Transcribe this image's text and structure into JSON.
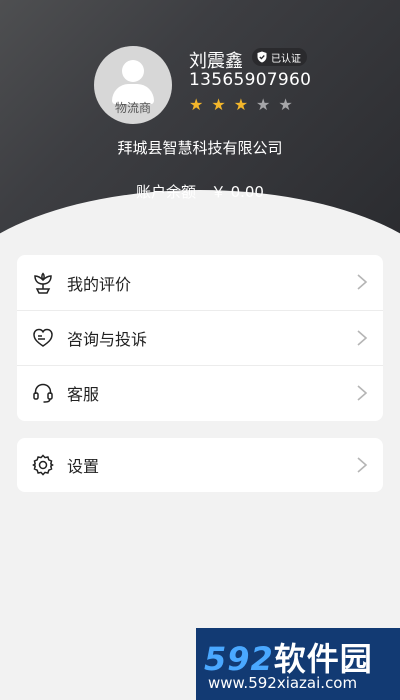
{
  "profile": {
    "role": "物流商",
    "name": "刘震鑫",
    "verified_label": "已认证",
    "phone": "13565907960",
    "rating": 3,
    "rating_max": 5,
    "company": "拜城县智慧科技有限公司",
    "balance_label": "账户余额",
    "balance_value": "￥ 0.00"
  },
  "menu": {
    "items": [
      {
        "label": "我的评价",
        "icon": "flower-icon"
      },
      {
        "label": "咨询与投诉",
        "icon": "heart-chat-icon"
      },
      {
        "label": "客服",
        "icon": "headset-icon"
      }
    ],
    "settings": {
      "label": "设置",
      "icon": "gear-icon"
    }
  },
  "watermark": {
    "num": "592",
    "cn": "软件园",
    "url": "www.592xiazai.com"
  },
  "colors": {
    "header_dark": "#2b2c30",
    "star_on": "#f3b62b",
    "star_off": "#a5a5a8",
    "watermark_bg": "#123a73"
  }
}
